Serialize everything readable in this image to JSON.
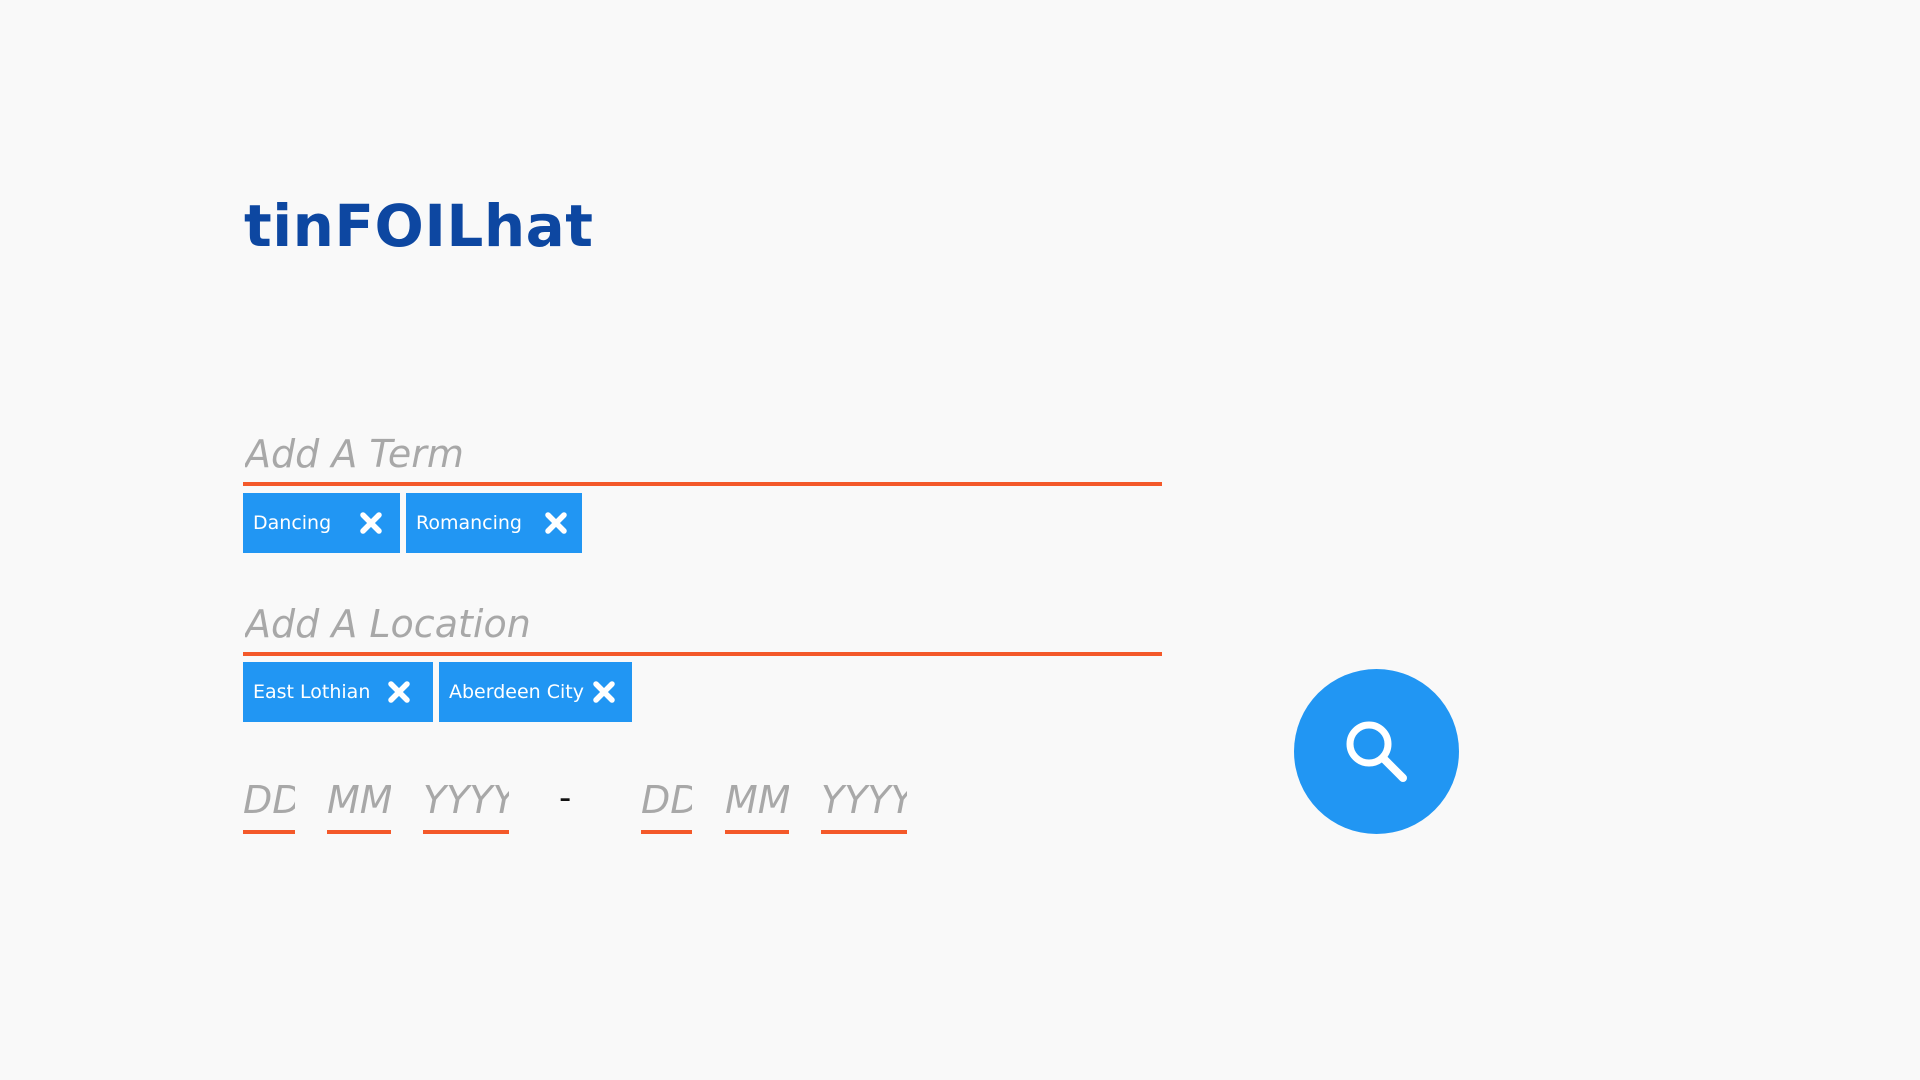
{
  "app": {
    "logo_text": "tinFOILhat"
  },
  "colors": {
    "background": "#f9f9f9",
    "logo": "#0d47a1",
    "accent_underline": "#f4592a",
    "chip_background": "#2196f3",
    "chip_text": "#ffffff",
    "placeholder": "#a8a8a8",
    "search_button": "#2196f3"
  },
  "term": {
    "placeholder": "Add A Term",
    "value": "",
    "chips": [
      {
        "label": "Dancing",
        "remove_icon": "close-x-icon"
      },
      {
        "label": "Romancing",
        "remove_icon": "close-x-icon"
      }
    ]
  },
  "location": {
    "placeholder": "Add A Location",
    "value": "",
    "chips": [
      {
        "label": "East Lothian",
        "remove_icon": "close-x-icon"
      },
      {
        "label": "Aberdeen City",
        "remove_icon": "close-x-icon"
      }
    ]
  },
  "date_range": {
    "separator": "-",
    "from": {
      "day_placeholder": "DD",
      "month_placeholder": "MM",
      "year_placeholder": "YYYY"
    },
    "to": {
      "day_placeholder": "DD",
      "month_placeholder": "MM",
      "year_placeholder": "YYYY"
    }
  },
  "search": {
    "icon": "search-icon"
  }
}
